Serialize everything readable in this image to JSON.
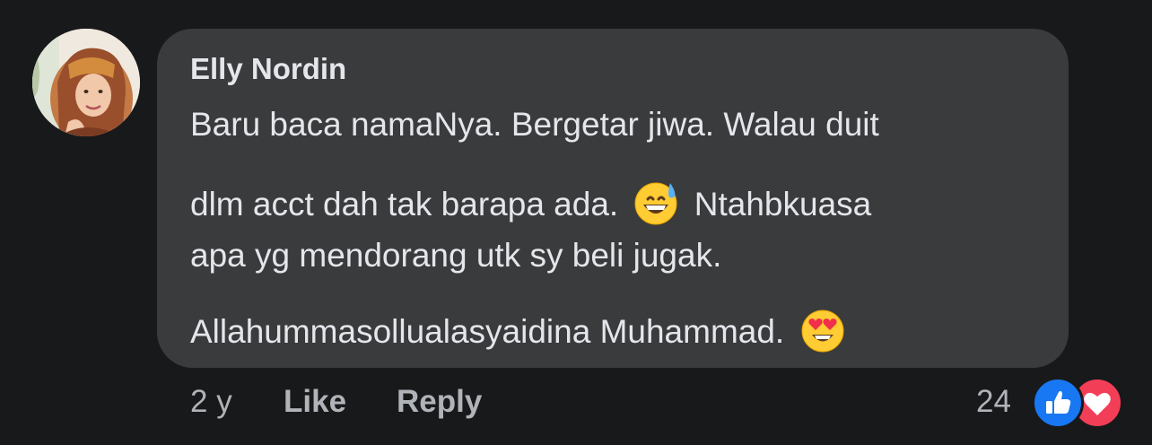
{
  "comment": {
    "author": "Elly Nordin",
    "lines": [
      "Baru baca namaNya. Bergetar jiwa. Walau duit",
      "dlm acct dah tak barapa ada.",
      "Ntahbkuasa",
      "apa yg mendorang utk sy beli jugak.",
      "Allahummasollualasyaidina Muhammad."
    ],
    "emojis": [
      "grinning-face-with-sweat",
      "smiling-face-with-heart-eyes"
    ]
  },
  "actions": {
    "time": "2 y",
    "like_label": "Like",
    "reply_label": "Reply"
  },
  "reactions": {
    "count": "24",
    "types": [
      "like",
      "love"
    ],
    "colors": {
      "like": "#1877f2",
      "love": "#f33e58"
    }
  },
  "colors": {
    "background": "#18191a",
    "bubble": "#3a3b3c",
    "text": "#e4e6eb",
    "secondary_text": "#b0b3b8"
  }
}
